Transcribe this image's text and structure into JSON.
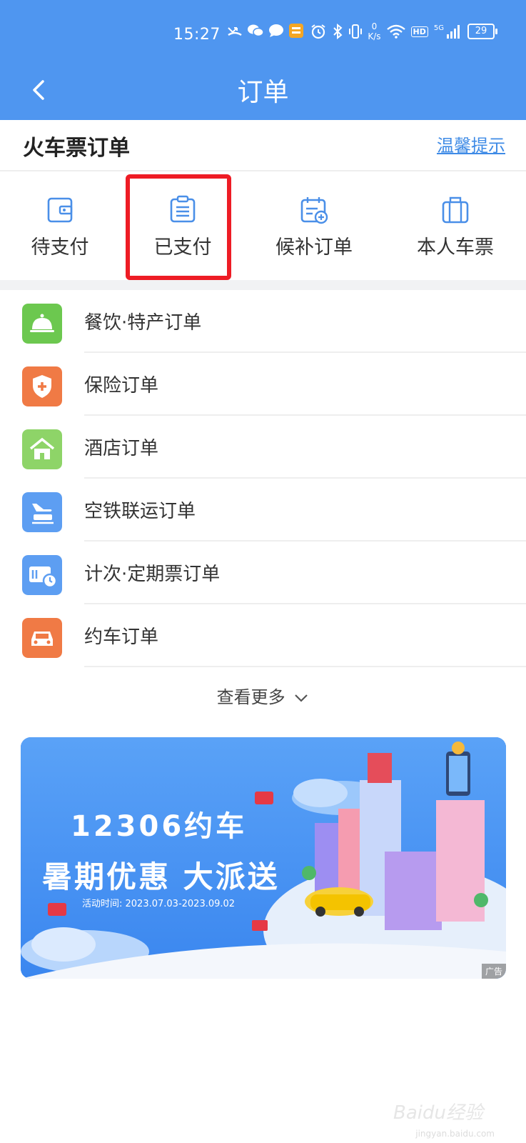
{
  "status_bar": {
    "time": "15:27",
    "net_speed_value": "0",
    "net_speed_unit": "K/s",
    "network": "HD",
    "signal": "5G",
    "battery": "29"
  },
  "navbar": {
    "title": "订单",
    "back_icon": "chevron-left-icon"
  },
  "section": {
    "title": "火车票订单",
    "tip_link": "温馨提示"
  },
  "tabs": [
    {
      "label": "待支付",
      "icon": "wallet-icon"
    },
    {
      "label": "已支付",
      "icon": "clipboard-icon"
    },
    {
      "label": "候补订单",
      "icon": "calendar-add-icon"
    },
    {
      "label": "本人车票",
      "icon": "suitcase-icon"
    }
  ],
  "list": [
    {
      "label": "餐饮·特产订单",
      "icon": "dining-bell-icon",
      "color": "#6cc84f"
    },
    {
      "label": "保险订单",
      "icon": "shield-plus-icon",
      "color": "#f07a45"
    },
    {
      "label": "酒店订单",
      "icon": "hotel-icon",
      "color": "#8ed468"
    },
    {
      "label": "空铁联运订单",
      "icon": "plane-train-icon",
      "color": "#5d9ef2"
    },
    {
      "label": "计次·定期票订单",
      "icon": "ticket-clock-icon",
      "color": "#5d9ef2"
    },
    {
      "label": "约车订单",
      "icon": "car-icon",
      "color": "#f07a45"
    }
  ],
  "more_label": "查看更多",
  "banner": {
    "headline": "12306约车",
    "subheadline": "暑期优惠 大派送",
    "period": "活动时间: 2023.07.03-2023.09.02",
    "ad_tag": "广告"
  },
  "watermark": {
    "logo": "Baidu经验",
    "site": "jingyan.baidu.com"
  },
  "colors": {
    "brand_blue": "#4f96f0",
    "highlight_red": "#ee1c25"
  }
}
